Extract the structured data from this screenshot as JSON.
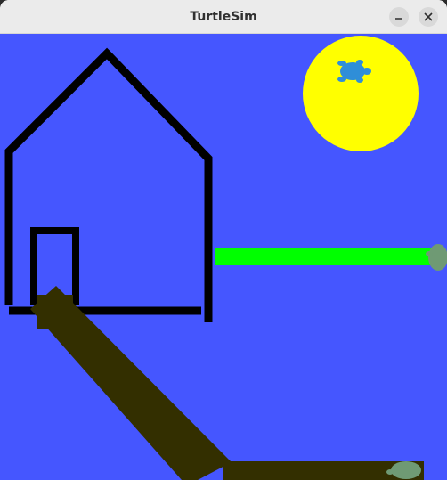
{
  "window": {
    "title": "TurtleSim",
    "controls": {
      "minimize_icon": "minimize-icon",
      "close_icon": "close-icon"
    }
  },
  "canvas": {
    "background_color": "#4556ff",
    "colors": {
      "house_pen": "#000000",
      "sun": "#ffff00",
      "grass_line": "#00ff00",
      "path": "#332f00",
      "turtle_blue": "#2f8ed8",
      "turtle_green": "#6f9a74"
    }
  }
}
